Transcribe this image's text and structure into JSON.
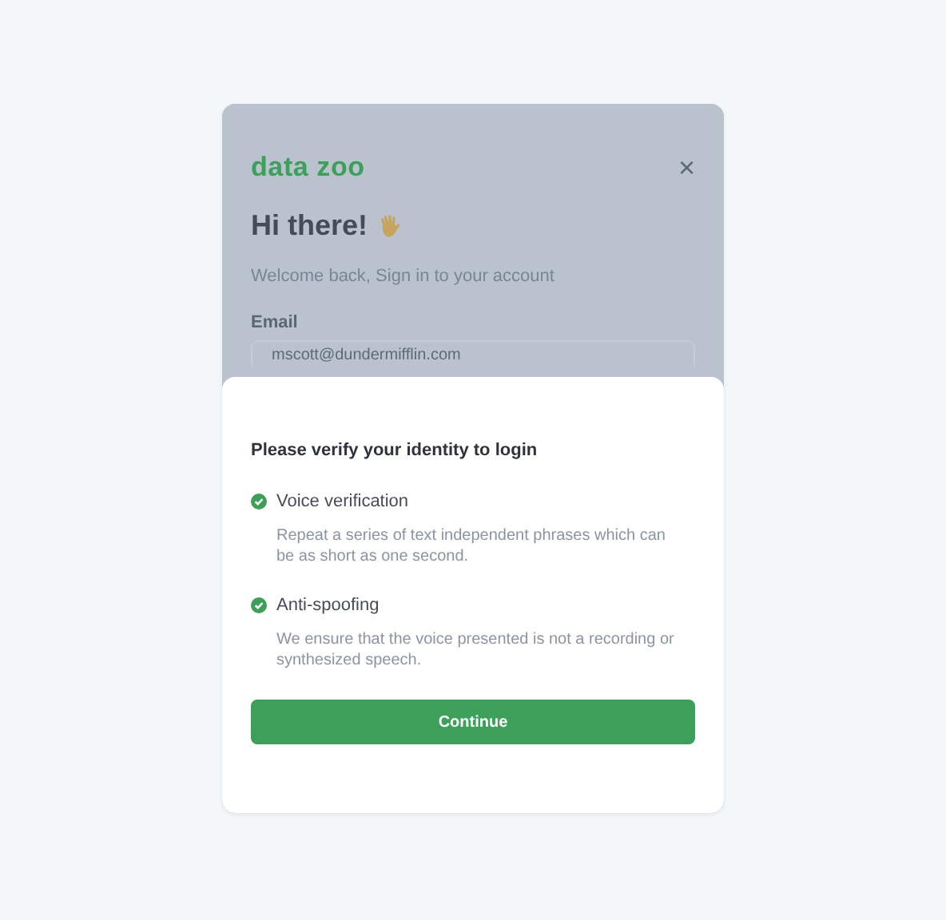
{
  "login": {
    "logo": "data zoo",
    "close": "×",
    "greeting": "Hi there!",
    "subtitle": "Welcome back, Sign in to your account",
    "email_label": "Email",
    "email_value": "mscott@dundermifflin.com"
  },
  "verify": {
    "title": "Please verify your identity to login",
    "features": [
      {
        "name": "Voice verification",
        "checked": true,
        "description": "Repeat a series of text independent phrases which can be as short as one second."
      },
      {
        "name": "Anti-spoofing",
        "checked": true,
        "description": "We ensure that the voice presented is not a recording or synthesized speech."
      }
    ],
    "button": "Continue"
  }
}
